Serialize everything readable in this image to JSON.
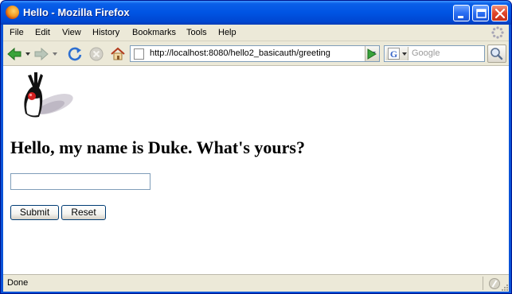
{
  "window": {
    "title": "Hello - Mozilla Firefox",
    "icon": "firefox-icon",
    "controls": [
      "minimize-icon",
      "maximize-icon",
      "close-icon"
    ]
  },
  "menubar": {
    "items": [
      {
        "label": "File"
      },
      {
        "label": "Edit"
      },
      {
        "label": "View"
      },
      {
        "label": "History"
      },
      {
        "label": "Bookmarks"
      },
      {
        "label": "Tools"
      },
      {
        "label": "Help"
      }
    ]
  },
  "navigation": {
    "buttons": [
      "back-icon",
      "forward-icon",
      "reload-icon",
      "stop-icon",
      "home-icon"
    ],
    "url": "http://localhost:8080/hello2_basicauth/greeting",
    "search_placeholder": "Google",
    "search_engine": "G"
  },
  "page": {
    "image": "duke-mascot",
    "heading": "Hello, my name is Duke. What's yours?",
    "input_value": "",
    "submit_label": "Submit",
    "reset_label": "Reset"
  },
  "statusbar": {
    "text": "Done"
  },
  "colors": {
    "titlebar": "#0054e3",
    "chrome": "#ece9d8",
    "input_border": "#7f9db9",
    "button_border": "#003c74"
  }
}
